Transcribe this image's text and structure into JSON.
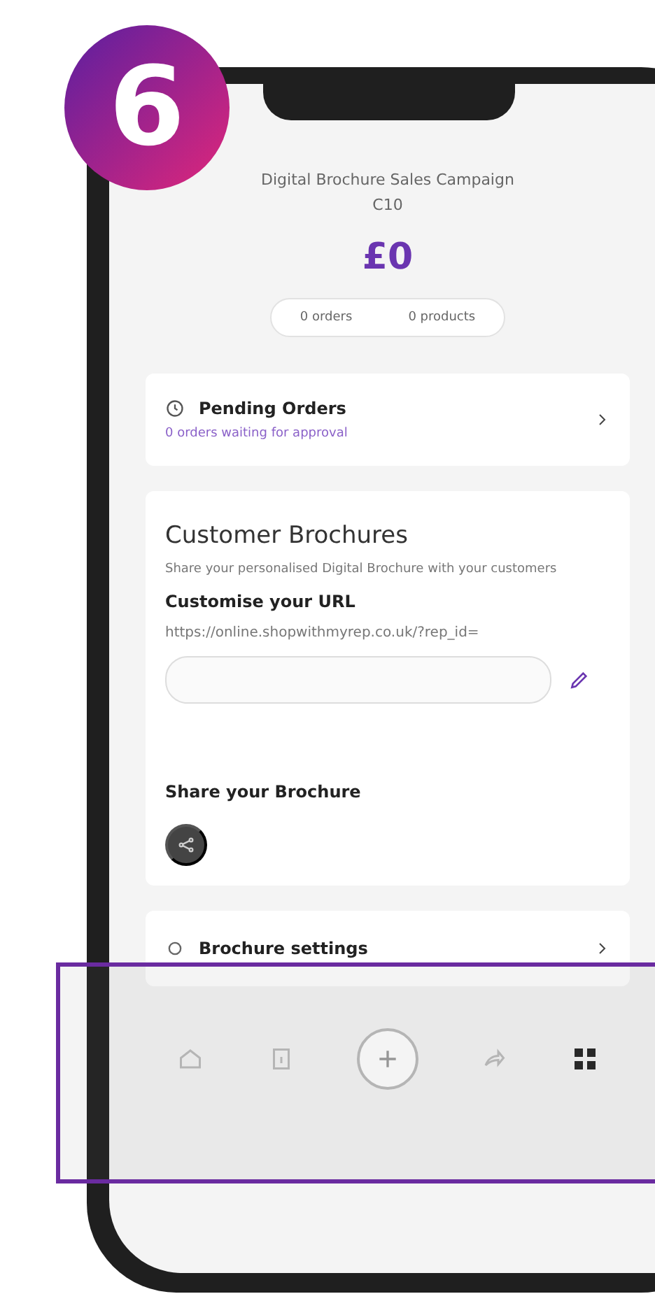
{
  "step_badge": "6",
  "campaign": {
    "title": "Digital Brochure Sales Campaign C10",
    "total": "£0",
    "stats": [
      "0 orders",
      "0 products"
    ]
  },
  "pending_orders": {
    "title": "Pending Orders",
    "subtitle": "0 orders waiting for approval"
  },
  "brochures": {
    "title": "Customer Brochures",
    "description": "Share your personalised Digital Brochure with your customers",
    "url_heading": "Customise your URL",
    "url": "https://online.shopwithmyrep.co.uk/?rep_id=",
    "share_heading": "Share your Brochure"
  },
  "settings": {
    "title": "Brochure settings"
  },
  "nav": [
    {
      "kind": "home",
      "selected": false
    },
    {
      "kind": "document",
      "selected": false
    },
    {
      "kind": "add",
      "selected": false
    },
    {
      "kind": "share",
      "selected": false
    },
    {
      "kind": "grid",
      "selected": true
    }
  ]
}
